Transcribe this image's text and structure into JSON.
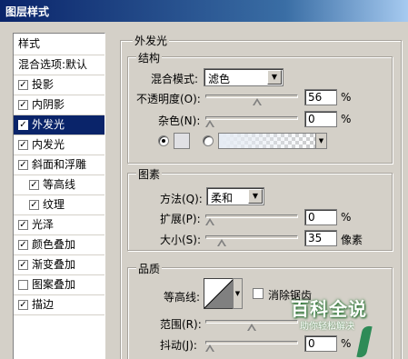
{
  "window": {
    "title": "图层样式"
  },
  "left_panel": {
    "header": "样式",
    "items": [
      {
        "label": "混合选项:默认",
        "checkbox": false,
        "checked": false,
        "indent": 0,
        "selected": false
      },
      {
        "label": "投影",
        "checkbox": true,
        "checked": true,
        "indent": 0,
        "selected": false
      },
      {
        "label": "内阴影",
        "checkbox": true,
        "checked": true,
        "indent": 0,
        "selected": false
      },
      {
        "label": "外发光",
        "checkbox": true,
        "checked": true,
        "indent": 0,
        "selected": true
      },
      {
        "label": "内发光",
        "checkbox": true,
        "checked": true,
        "indent": 0,
        "selected": false
      },
      {
        "label": "斜面和浮雕",
        "checkbox": true,
        "checked": true,
        "indent": 0,
        "selected": false
      },
      {
        "label": "等高线",
        "checkbox": true,
        "checked": true,
        "indent": 1,
        "selected": false
      },
      {
        "label": "纹理",
        "checkbox": true,
        "checked": true,
        "indent": 1,
        "selected": false
      },
      {
        "label": "光泽",
        "checkbox": true,
        "checked": true,
        "indent": 0,
        "selected": false
      },
      {
        "label": "颜色叠加",
        "checkbox": true,
        "checked": true,
        "indent": 0,
        "selected": false
      },
      {
        "label": "渐变叠加",
        "checkbox": true,
        "checked": true,
        "indent": 0,
        "selected": false
      },
      {
        "label": "图案叠加",
        "checkbox": true,
        "checked": false,
        "indent": 0,
        "selected": false
      },
      {
        "label": "描边",
        "checkbox": true,
        "checked": true,
        "indent": 0,
        "selected": false
      }
    ]
  },
  "outer_glow": {
    "section_title": "外发光",
    "structure": {
      "title": "结构",
      "blend_mode_label": "混合模式:",
      "blend_mode_value": "滤色",
      "opacity_label": "不透明度(O):",
      "opacity_value": "56",
      "opacity_unit": "%",
      "opacity_fraction": 0.56,
      "noise_label": "杂色(N):",
      "noise_value": "0",
      "noise_unit": "%",
      "noise_fraction": 0.0,
      "color_mode": "solid",
      "color_swatch": "#e0e0e4"
    },
    "elements": {
      "title": "图素",
      "method_label": "方法(Q):",
      "method_value": "柔和",
      "spread_label": "扩展(P):",
      "spread_value": "0",
      "spread_unit": "%",
      "spread_fraction": 0.0,
      "size_label": "大小(S):",
      "size_value": "35",
      "size_unit": "像素",
      "size_fraction": 0.14
    },
    "quality": {
      "title": "品质",
      "contour_label": "等高线:",
      "antialias_label": "消除锯齿",
      "antialias_checked": false,
      "range_label": "范围(R):",
      "range_fraction": 0.5,
      "jitter_label": "抖动(J):",
      "jitter_value": "0",
      "jitter_unit": "%",
      "jitter_fraction": 0.0
    }
  },
  "watermark": {
    "main": "百科全说",
    "sub": "助你轻松解决"
  }
}
